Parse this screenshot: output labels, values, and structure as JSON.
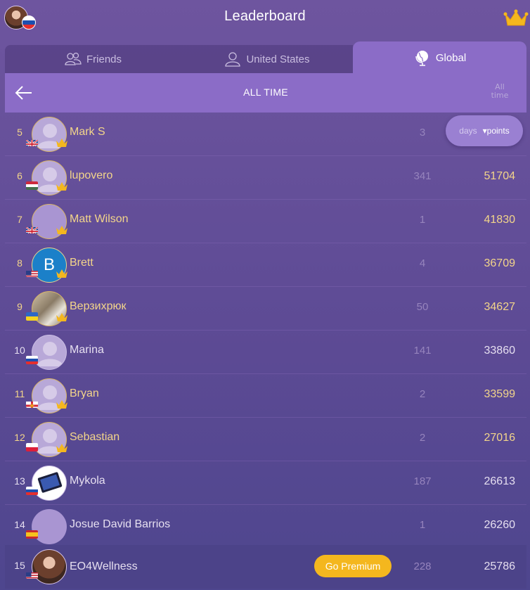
{
  "header": {
    "title": "Leaderboard",
    "user_avatar_icon": "user-avatar",
    "user_flag_icon": "flag-slovakia-icon",
    "crown_icon": "crown-icon"
  },
  "tabs": [
    {
      "label": "Friends",
      "icon": "friends-icon",
      "active": false
    },
    {
      "label": "United States",
      "icon": "user-icon",
      "active": false
    },
    {
      "label": "Global",
      "icon": "globe-icon",
      "active": true
    }
  ],
  "panel": {
    "title": "ALL TIME",
    "back_icon": "back-arrow-icon",
    "period_label": "All time"
  },
  "sort_toggle": {
    "days_label": "days",
    "points_label": "points",
    "selected": "points"
  },
  "rows": [
    {
      "rank": "5",
      "name": "Mark S",
      "days": "3",
      "points": "",
      "flag": "uk",
      "crown": true,
      "avatar": "default"
    },
    {
      "rank": "6",
      "name": "lupovero",
      "days": "341",
      "points": "51704",
      "flag": "hungary",
      "crown": true,
      "avatar": "default"
    },
    {
      "rank": "7",
      "name": "Matt Wilson",
      "days": "1",
      "points": "41830",
      "flag": "uk",
      "crown": true,
      "avatar": "blank"
    },
    {
      "rank": "8",
      "name": "Brett",
      "days": "4",
      "points": "36709",
      "flag": "usa",
      "crown": true,
      "avatar": "letter",
      "avatar_letter": "B"
    },
    {
      "rank": "9",
      "name": "Верзихрюк",
      "days": "50",
      "points": "34627",
      "flag": "ukraine",
      "crown": true,
      "avatar": "photo"
    },
    {
      "rank": "10",
      "name": "Marina",
      "days": "141",
      "points": "33860",
      "flag": "slovakia",
      "crown": false,
      "avatar": "default"
    },
    {
      "rank": "11",
      "name": "Bryan",
      "days": "2",
      "points": "33599",
      "flag": "guernsey",
      "crown": true,
      "avatar": "default"
    },
    {
      "rank": "12",
      "name": "Sebastian",
      "days": "2",
      "points": "27016",
      "flag": "poland",
      "crown": true,
      "avatar": "default"
    },
    {
      "rank": "13",
      "name": "Mykola",
      "days": "187",
      "points": "26613",
      "flag": "slovakia",
      "crown": false,
      "avatar": "photo"
    },
    {
      "rank": "14",
      "name": "Josue David Barrios",
      "days": "1",
      "points": "26260",
      "flag": "spain",
      "crown": false,
      "avatar": "blank"
    },
    {
      "rank": "15",
      "name": "EO4Wellness",
      "days": "228",
      "points": "25786",
      "flag": "usa",
      "crown": false,
      "avatar": "photo",
      "is_self": true,
      "cta_label": "Go Premium"
    }
  ],
  "colors": {
    "accent_gold": "#f3d58a",
    "premium_button": "#f4b71e",
    "active_tab": "#8b6cc7"
  }
}
